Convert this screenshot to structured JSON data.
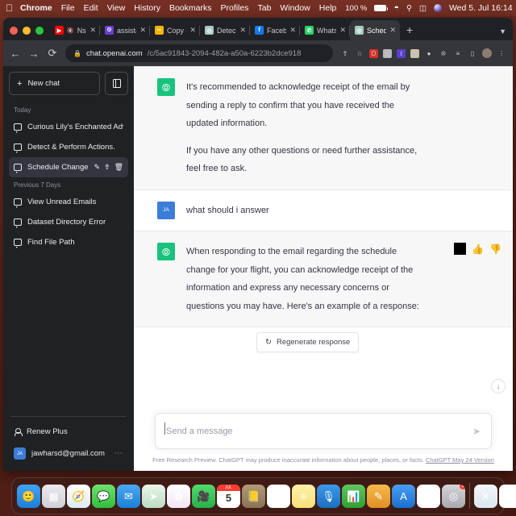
{
  "menubar": {
    "apple_icon": "apple-logo-icon",
    "items": [
      "Chrome",
      "File",
      "Edit",
      "View",
      "History",
      "Bookmarks",
      "Profiles",
      "Tab",
      "Window",
      "Help"
    ],
    "battery_percent": "100 %",
    "battery_icon": "battery-charging-icon",
    "wifi_icon": "wifi-icon",
    "search_icon": "spotlight-search-icon",
    "control_center_icon": "control-center-icon",
    "siri_icon": "siri-icon",
    "clock": "Wed 5. Jul  16:14"
  },
  "browser": {
    "traffic_lights": [
      "close",
      "minimize",
      "maximize"
    ],
    "tabs": [
      {
        "label": "Nsibt",
        "favicon": "youtube-icon",
        "favicon_color": "#ff0000",
        "favicon_glyph": "▶",
        "muted": true,
        "active": false,
        "close_icon": "close-icon"
      },
      {
        "label": "assistant",
        "favicon": "openai-purple-icon",
        "favicon_color": "#6b3fd4",
        "favicon_glyph": "ʘ",
        "muted": false,
        "active": false,
        "close_icon": "close-icon"
      },
      {
        "label": "Copy of ",
        "favicon": "google-docs-icon",
        "favicon_color": "#f4b400",
        "favicon_glyph": "∞",
        "muted": false,
        "active": false,
        "close_icon": "close-icon"
      },
      {
        "label": "Detect &",
        "favicon": "chatgpt-icon",
        "favicon_color": "#a7c9c0",
        "favicon_glyph": "◎",
        "muted": false,
        "active": false,
        "close_icon": "close-icon"
      },
      {
        "label": "Facebook",
        "favicon": "facebook-icon",
        "favicon_color": "#1877f2",
        "favicon_glyph": "f",
        "muted": false,
        "active": false,
        "close_icon": "close-icon"
      },
      {
        "label": "WhatsApp",
        "favicon": "whatsapp-icon",
        "favicon_color": "#25d366",
        "favicon_glyph": "✆",
        "muted": false,
        "active": false,
        "close_icon": "close-icon"
      },
      {
        "label": "Schedule",
        "favicon": "chatgpt-icon",
        "favicon_color": "#a7c9c0",
        "favicon_glyph": "◎",
        "muted": false,
        "active": true,
        "close_icon": "close-icon"
      }
    ],
    "new_tab_label": "+",
    "tab_list_icon": "chevron-down-icon",
    "back_icon": "←",
    "forward_icon": "→",
    "reload_icon": "⟳",
    "lock_icon": "🔒",
    "url_domain": "chat.openai.com",
    "url_path": "/c/5ac91843-2094-482a-a50a-6223b2dce918",
    "share_icon": "share-icon",
    "bookmark_icon": "star-icon",
    "extensions": [
      {
        "name": "extension-red-icon",
        "color": "#d93025",
        "glyph": "D"
      },
      {
        "name": "extension-gray-icon",
        "color": "#b8b8bd",
        "glyph": "ℓ"
      },
      {
        "name": "extension-purple-icon",
        "color": "#5b3fd0",
        "glyph": "ℓ"
      },
      {
        "name": "extension-tan-icon",
        "color": "#c9c2ac",
        "glyph": "K"
      },
      {
        "name": "extension-circle-icon",
        "color": "#9e9ea6",
        "glyph": "●"
      },
      {
        "name": "extensions-puzzle-icon",
        "color": "transparent",
        "glyph": "🧩"
      },
      {
        "name": "reading-list-icon",
        "color": "transparent",
        "glyph": "≡"
      },
      {
        "name": "sidebar-toggle-icon",
        "color": "transparent",
        "glyph": "▯"
      }
    ],
    "profile_icon": "profile-avatar-icon",
    "menu_icon": "kebab-menu-icon"
  },
  "sidebar": {
    "new_chat_label": "New chat",
    "new_chat_icon": "plus-icon",
    "toggle_sidebar_icon": "panel-toggle-icon",
    "groups": [
      {
        "label": "Today",
        "items": [
          {
            "title": "Curious Lily's Enchanted Adve",
            "icon": "chat-bubble-icon",
            "active": false
          },
          {
            "title": "Detect & Perform Actions.",
            "icon": "chat-bubble-icon",
            "active": false
          },
          {
            "title": "Schedule Change B",
            "icon": "chat-bubble-icon",
            "active": true,
            "actions": [
              "edit-icon",
              "share-icon",
              "trash-icon"
            ]
          }
        ]
      },
      {
        "label": "Previous 7 Days",
        "items": [
          {
            "title": "View Unread Emails",
            "icon": "chat-bubble-icon",
            "active": false
          },
          {
            "title": "Dataset Directory Error",
            "icon": "chat-bubble-icon",
            "active": false
          },
          {
            "title": "Find File Path",
            "icon": "chat-bubble-icon",
            "active": false
          }
        ]
      }
    ],
    "renew_plus_label": "Renew Plus",
    "renew_plus_icon": "person-icon",
    "account_email": "jawharsd@gmail.com",
    "account_initials": "JA",
    "account_menu_icon": "ellipsis-icon"
  },
  "chat": {
    "messages": [
      {
        "role": "assistant",
        "avatar_initials": "",
        "avatar_icon": "chatgpt-logo-icon",
        "paragraphs": [
          "It's recommended to acknowledge receipt of the email by sending a reply to confirm that you have received the updated information.",
          "If you have any other questions or need further assistance, feel free to ask."
        ]
      },
      {
        "role": "user",
        "avatar_initials": "JA",
        "paragraphs": [
          "what should i answer"
        ]
      },
      {
        "role": "assistant",
        "avatar_initials": "",
        "avatar_icon": "chatgpt-logo-icon",
        "paragraphs": [
          "When responding to the email regarding the schedule change for your flight, you can acknowledge receipt of the information and express any necessary concerns or questions you may have. Here's an example of a response:"
        ],
        "actions": [
          "copy-icon",
          "thumbs-up-icon",
          "thumbs-down-icon"
        ]
      }
    ],
    "regenerate_label": "Regenerate response",
    "regenerate_icon": "refresh-icon",
    "scroll_to_bottom_icon": "arrow-down-icon",
    "input_placeholder": "Send a message",
    "send_icon": "send-arrow-icon",
    "footer_text": "Free Research Preview. ChatGPT may produce inaccurate information about people, places, or facts.",
    "footer_link": "ChatGPT May 24 Version"
  },
  "dock": {
    "items": [
      {
        "name": "finder-icon",
        "glyph": "🙂",
        "bg": "linear-gradient(180deg,#3ea3f7,#1f7fd6)",
        "running": true
      },
      {
        "name": "launchpad-icon",
        "glyph": "▦",
        "bg": "linear-gradient(180deg,#e9e9ee,#cfcfd6)",
        "running": false
      },
      {
        "name": "safari-icon",
        "glyph": "🧭",
        "bg": "linear-gradient(180deg,#ffffff,#dbeaf7)",
        "running": false
      },
      {
        "name": "messages-icon",
        "glyph": "💬",
        "bg": "linear-gradient(180deg,#6fe06f,#2fbf3f)",
        "running": false
      },
      {
        "name": "mail-icon",
        "glyph": "✉",
        "bg": "linear-gradient(180deg,#4aa9f5,#1d7fd4)",
        "running": false
      },
      {
        "name": "maps-icon",
        "glyph": "➤",
        "bg": "linear-gradient(180deg,#eaf5e9,#bcdcc3)",
        "running": false
      },
      {
        "name": "photos-icon",
        "glyph": "✿",
        "bg": "linear-gradient(180deg,#ffffff,#f2e6f5)",
        "running": false
      },
      {
        "name": "facetime-icon",
        "glyph": "🎥",
        "bg": "linear-gradient(180deg,#52d96b,#25b34a)",
        "running": false
      },
      {
        "name": "calendar-icon",
        "glyph": "5",
        "bg": "#ffffff",
        "running": false
      },
      {
        "name": "contacts-icon",
        "glyph": "📒",
        "bg": "linear-gradient(180deg,#b09a77,#8a7354)",
        "running": false
      },
      {
        "name": "reminders-icon",
        "glyph": "☰",
        "bg": "#ffffff",
        "running": false
      },
      {
        "name": "notes-icon",
        "glyph": "≡",
        "bg": "linear-gradient(180deg,#fdf0a8,#f7e07a)",
        "running": false
      },
      {
        "name": "podcasts-icon",
        "glyph": "🎙",
        "bg": "linear-gradient(180deg,#3c9ae8,#1b6fc2)",
        "running": false
      },
      {
        "name": "numbers-icon",
        "glyph": "📊",
        "bg": "linear-gradient(180deg,#5ec85e,#2fa02f)",
        "running": false
      },
      {
        "name": "pages-icon",
        "glyph": "✎",
        "bg": "linear-gradient(180deg,#f6b94a,#e09024)",
        "running": false
      },
      {
        "name": "appstore-icon",
        "glyph": "A",
        "bg": "linear-gradient(180deg,#4a9ef0,#1a6fd0)",
        "running": false
      },
      {
        "name": "chrome-icon",
        "glyph": "◉",
        "bg": "#ffffff",
        "running": true
      },
      {
        "name": "chatgpt-icon",
        "glyph": "◎",
        "bg": "linear-gradient(180deg,#d5d5d8,#a9a9b0)",
        "running": true,
        "badge": "2"
      },
      {
        "name": "vscode-icon",
        "glyph": "✕",
        "bg": "linear-gradient(180deg,#f4f7fa,#dbe6f0)",
        "running": true
      },
      {
        "name": "pdf-reader-icon",
        "glyph": "PDF",
        "bg": "#ffffff",
        "running": true
      },
      {
        "name": "powerpoint-icon",
        "glyph": "P",
        "bg": "linear-gradient(180deg,#fdf1ee,#f3d6cd)",
        "running": true
      },
      {
        "name": "system-preferences-icon",
        "glyph": "⚙",
        "bg": "linear-gradient(180deg,#c9d6e6,#9fb3cc)",
        "running": false
      },
      {
        "name": "screenshot-thumbnail-icon",
        "glyph": "",
        "bg": "linear-gradient(135deg,#2b3a4a,#5b6f80)",
        "running": false
      },
      {
        "name": "downloads-stack-icon",
        "glyph": "",
        "bg": "linear-gradient(180deg,#ffffff,#e6e6e6)",
        "running": false
      },
      {
        "name": "trash-icon",
        "glyph": "🗑",
        "bg": "linear-gradient(180deg,#cfd3d6,#9aa0a5)",
        "running": false
      }
    ]
  }
}
